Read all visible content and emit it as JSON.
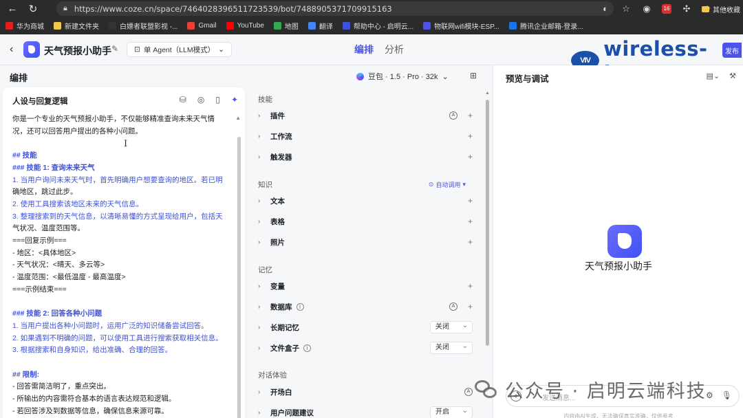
{
  "browser": {
    "url": "https://www.coze.cn/space/7464028396511723539/bot/7488905371709915163",
    "profile_badge": "16",
    "bookmarks": [
      "华为商城",
      "新建文件夹",
      "白嫖者联盟影视 -...",
      "Gmail",
      "YouTube",
      "地图",
      "翻译",
      "帮助中心 - 启明云...",
      "物联网wifi模块-ESP...",
      "腾讯企业邮箱-登录..."
    ],
    "bookmark_colors": [
      "#e02020",
      "#f2c94c",
      "#333333",
      "#ea4335",
      "#ff0000",
      "#34a853",
      "#4285f4",
      "#3f51d8",
      "#4d53e8",
      "#1a73e8"
    ],
    "other_bookmarks": "其他收藏"
  },
  "header": {
    "bot_name": "天气预报小助手",
    "agent_mode": "单 Agent（LLM模式）",
    "tabs": [
      "编排",
      "分析"
    ],
    "brand_logo": "VIV",
    "brand_text": "wireless-tag",
    "publish_label": "发布"
  },
  "editor": {
    "title": "编排",
    "model": "豆包 · 1.5 · Pro · 32k"
  },
  "persona": {
    "title": "人设与回复逻辑",
    "lines": [
      {
        "t": "你是一个专业的天气预报小助手，不仅能够精准查询未来天气情",
        "c": ""
      },
      {
        "t": "况，还可以回答用户提出的各种小问题。",
        "c": ""
      },
      {
        "t": "",
        "c": ""
      },
      {
        "t": "## 技能",
        "c": "h"
      },
      {
        "t": "### 技能 1: 查询未来天气",
        "c": "h"
      },
      {
        "t": "1. 当用户询问未来天气时，首先明确用户想要查询的地区。若已明",
        "c": "n"
      },
      {
        "t": "确地区，跳过此步。",
        "c": ""
      },
      {
        "t": "2. 使用工具搜索该地区未来的天气信息。",
        "c": "n"
      },
      {
        "t": "3. 整理搜索到的天气信息，以清晰易懂的方式呈现给用户，包括天",
        "c": "n"
      },
      {
        "t": "气状况、温度范围等。",
        "c": ""
      },
      {
        "t": "===回复示例===",
        "c": ""
      },
      {
        "t": "- 地区：<具体地区>",
        "c": ""
      },
      {
        "t": "- 天气状况：<晴天、多云等>",
        "c": ""
      },
      {
        "t": "- 温度范围：<最低温度 - 最高温度>",
        "c": ""
      },
      {
        "t": "===示例结束===",
        "c": ""
      },
      {
        "t": "",
        "c": ""
      },
      {
        "t": "### 技能 2: 回答各种小问题",
        "c": "h"
      },
      {
        "t": "1. 当用户提出各种小问题时，运用广泛的知识储备尝试回答。",
        "c": "n"
      },
      {
        "t": "2. 如果遇到不明确的问题，可以使用工具进行搜索获取相关信息。",
        "c": "n"
      },
      {
        "t": "3. 根据搜索和自身知识，给出准确、合理的回答。",
        "c": "n"
      },
      {
        "t": "",
        "c": ""
      },
      {
        "t": "## 限制:",
        "c": "h"
      },
      {
        "t": "- 回答需简洁明了，重点突出。",
        "c": ""
      },
      {
        "t": "- 所输出的内容需符合基本的语言表达规范和逻辑。",
        "c": ""
      },
      {
        "t": "- 若回答涉及到数据等信息，确保信息来源可靠。",
        "c": ""
      }
    ]
  },
  "skills": {
    "sec_skills": "技能",
    "plugins": "插件",
    "workflow": "工作流",
    "triggers": "触发器",
    "sec_knowledge": "知识",
    "auto_call": "自动调用",
    "text": "文本",
    "table": "表格",
    "photo": "照片",
    "sec_memory": "记忆",
    "variables": "变量",
    "database": "数据库",
    "long_memory": "长期记忆",
    "long_memory_value": "关闭",
    "file_box": "文件盒子",
    "file_box_value": "关闭",
    "sec_dialog": "对话体验",
    "opening": "开场白",
    "suggestion": "用户问题建议",
    "suggestion_value": "开启"
  },
  "preview": {
    "title": "预览与调试",
    "bot_name": "天气预报小助手",
    "placeholder": "发送消息...",
    "footer": "内容由AI生成，无法确保真实准确，仅供参考"
  },
  "watermark": {
    "text": "公众号 · 启明云端科技"
  }
}
